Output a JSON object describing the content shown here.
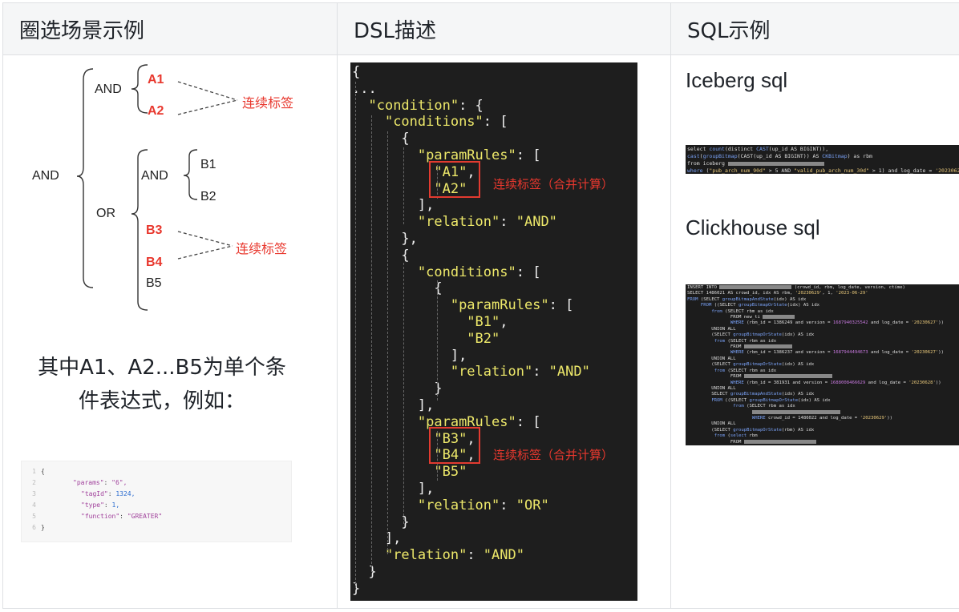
{
  "header": {
    "col1": "圈选场景示例",
    "col2": "DSL描述",
    "col3": "SQL示例"
  },
  "tree": {
    "root": "AND",
    "and1": "AND",
    "a1": "A1",
    "a2": "A2",
    "anno1": "连续标签",
    "or": "OR",
    "and2": "AND",
    "b1": "B1",
    "b2": "B2",
    "b3": "B3",
    "b4": "B4",
    "b5": "B5",
    "anno2": "连续标签"
  },
  "description": {
    "line1": "其中A1、A2...B5为单个条",
    "line2": "件表达式，例如："
  },
  "snippet": {
    "lines": [
      {
        "no": "1",
        "text": "{"
      },
      {
        "no": "2",
        "key": "\"params\"",
        "val": "\"6\","
      },
      {
        "no": "3",
        "key": "\"tagId\"",
        "val": "1324,"
      },
      {
        "no": "4",
        "key": "\"type\"",
        "val": "1,"
      },
      {
        "no": "5",
        "key": "\"function\"",
        "val": "\"GREATER\""
      },
      {
        "no": "6",
        "text": "}"
      }
    ]
  },
  "dsl": {
    "note1": "连续标签（合并计算）",
    "note2": "连续标签（合并计算）"
  },
  "sql": {
    "iceberg_title": "Iceberg sql",
    "clickhouse_title": "Clickhouse sql"
  },
  "colors": {
    "red": "#e8382e",
    "code_bg": "#1e1e1e",
    "key_yellow": "#ede86a"
  }
}
